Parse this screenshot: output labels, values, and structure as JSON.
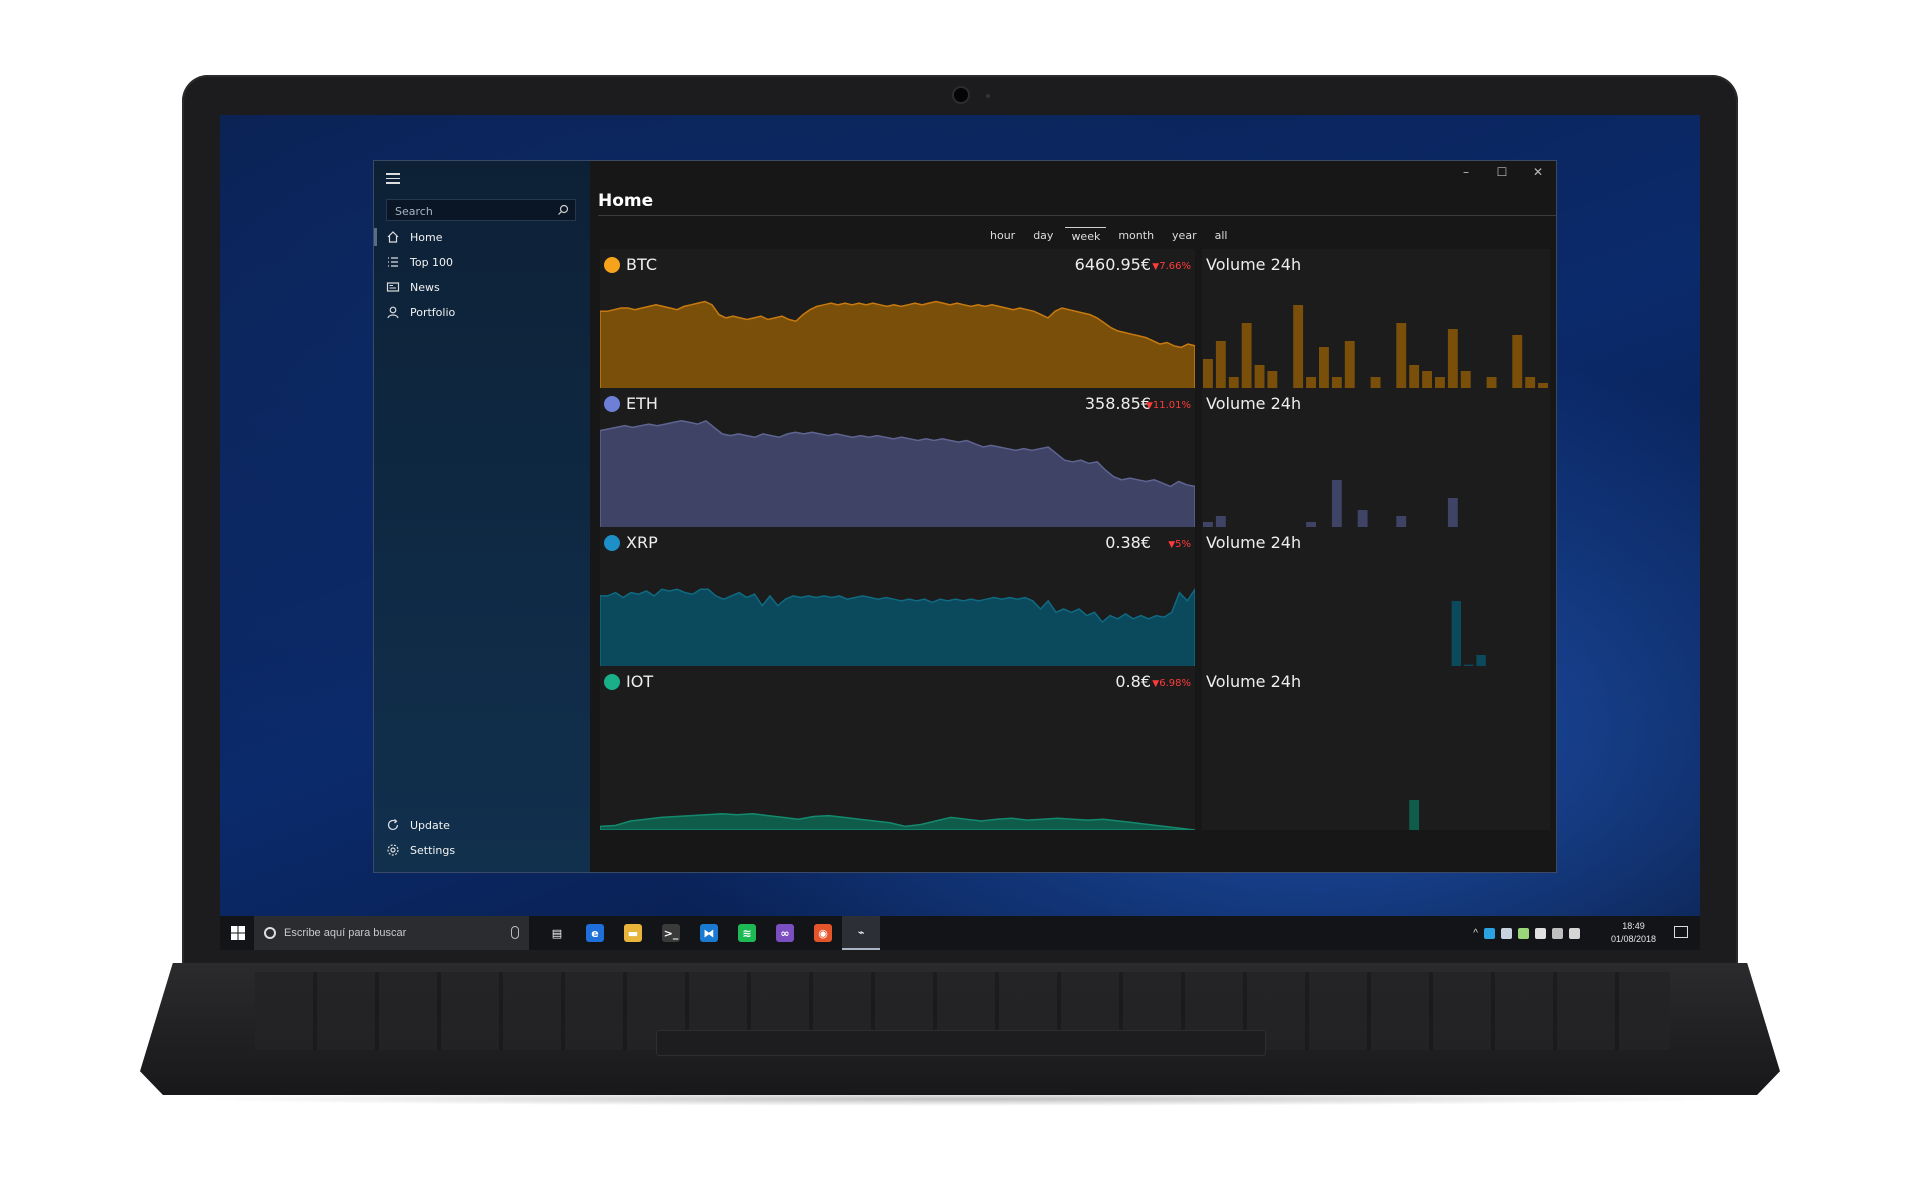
{
  "app": {
    "title": "Home",
    "search": {
      "placeholder": "Search"
    },
    "nav": [
      {
        "label": "Home",
        "icon": "home-icon",
        "active": true
      },
      {
        "label": "Top 100",
        "icon": "list-icon",
        "active": false
      },
      {
        "label": "News",
        "icon": "news-icon",
        "active": false
      },
      {
        "label": "Portfolio",
        "icon": "person-icon",
        "active": false
      }
    ],
    "nav_bottom": [
      {
        "label": "Update",
        "icon": "refresh-icon"
      },
      {
        "label": "Settings",
        "icon": "gear-icon"
      }
    ],
    "window_buttons": {
      "minimize": "–",
      "maximize": "☐",
      "close": "✕"
    },
    "ranges": [
      {
        "label": "hour",
        "active": false
      },
      {
        "label": "day",
        "active": false
      },
      {
        "label": "week",
        "active": true
      },
      {
        "label": "month",
        "active": false
      },
      {
        "label": "year",
        "active": false
      },
      {
        "label": "all",
        "active": false
      }
    ],
    "volume_title": "Volume 24h"
  },
  "coins": [
    {
      "symbol": "BTC",
      "price": "6460.95€",
      "change": "7.66%",
      "color": "#c77a10",
      "fill": "#7a4f0a",
      "icon_color": "#f7a21b"
    },
    {
      "symbol": "ETH",
      "price": "358.85€",
      "change": "11.01%",
      "color": "#5f6491",
      "fill": "#3f4365",
      "icon_color": "#6e7fd8"
    },
    {
      "symbol": "XRP",
      "price": "0.38€",
      "change": "5%",
      "color": "#0f6a82",
      "fill": "#0b4a5c",
      "icon_color": "#1e90c8"
    },
    {
      "symbol": "IOT",
      "price": "0.8€",
      "change": "6.98%",
      "color": "#138a6e",
      "fill": "#0f5c4a",
      "icon_color": "#19b089"
    }
  ],
  "chart_data": [
    {
      "type": "area",
      "series": [
        {
          "name": "BTC",
          "values": [
            62,
            62,
            63,
            64,
            64,
            63,
            64,
            65,
            66,
            65,
            64,
            63,
            65,
            66,
            67,
            68,
            66,
            60,
            58,
            59,
            58,
            57,
            58,
            59,
            57,
            58,
            59,
            57,
            56,
            60,
            63,
            65,
            66,
            67,
            66,
            67,
            66,
            67,
            66,
            67,
            66,
            65,
            66,
            65,
            66,
            67,
            66,
            67,
            68,
            67,
            66,
            67,
            66,
            65,
            66,
            65,
            66,
            65,
            64,
            63,
            64,
            63,
            62,
            60,
            58,
            62,
            64,
            63,
            62,
            61,
            60,
            58,
            55,
            52,
            50,
            49,
            48,
            47,
            46,
            44,
            42,
            43,
            41,
            40,
            42,
            41
          ]
        }
      ]
    },
    {
      "type": "area",
      "series": [
        {
          "name": "ETH",
          "values": [
            74,
            75,
            76,
            77,
            76,
            77,
            78,
            77,
            78,
            79,
            80,
            79,
            78,
            80,
            76,
            72,
            71,
            72,
            71,
            70,
            72,
            71,
            70,
            72,
            73,
            72,
            73,
            72,
            71,
            72,
            71,
            70,
            71,
            70,
            71,
            70,
            69,
            70,
            69,
            68,
            69,
            68,
            69,
            68,
            67,
            68,
            66,
            64,
            65,
            64,
            63,
            62,
            63,
            62,
            63,
            64,
            60,
            56,
            55,
            56,
            54,
            55,
            50,
            46,
            44,
            45,
            44,
            43,
            44,
            42,
            40,
            43,
            41,
            40
          ]
        }
      ]
    },
    {
      "type": "area",
      "series": [
        {
          "name": "XRP",
          "values": [
            58,
            58,
            60,
            57,
            60,
            59,
            61,
            58,
            62,
            61,
            62,
            60,
            59,
            62,
            62,
            58,
            56,
            58,
            60,
            57,
            59,
            52,
            58,
            52,
            56,
            58,
            57,
            58,
            57,
            58,
            57,
            58,
            56,
            57,
            58,
            57,
            56,
            57,
            56,
            55,
            56,
            55,
            56,
            54,
            56,
            55,
            56,
            55,
            56,
            55,
            56,
            57,
            56,
            57,
            56,
            57,
            55,
            50,
            55,
            48,
            50,
            48,
            50,
            46,
            48,
            42,
            46,
            44,
            47,
            44,
            46,
            44,
            46,
            45,
            48,
            60,
            55,
            62
          ]
        }
      ]
    },
    {
      "type": "area",
      "series": [
        {
          "name": "IOT",
          "values": [
            4,
            5,
            10,
            12,
            14,
            15,
            16,
            17,
            18,
            17,
            18,
            16,
            14,
            12,
            15,
            16,
            14,
            12,
            10,
            8,
            4,
            6,
            10,
            14,
            12,
            10,
            12,
            13,
            11,
            12,
            13,
            12,
            11,
            12,
            10,
            8,
            6,
            4,
            2,
            0
          ]
        }
      ]
    },
    {
      "type": "bar",
      "series": [
        {
          "name": "BTC Volume 24h",
          "values": [
            45,
            60,
            30,
            75,
            40,
            35,
            15,
            90,
            30,
            55,
            30,
            60,
            15,
            30,
            15,
            75,
            40,
            35,
            30,
            70,
            35,
            15,
            30,
            15,
            65,
            30,
            25
          ]
        }
      ]
    },
    {
      "type": "bar",
      "series": [
        {
          "name": "ETH Volume 24h",
          "values": [
            25,
            30,
            12,
            10,
            12,
            10,
            12,
            10,
            25,
            10,
            60,
            12,
            35,
            10,
            20,
            30,
            15,
            20,
            10,
            45,
            15,
            20,
            10,
            12,
            10,
            15,
            12
          ]
        }
      ]
    },
    {
      "type": "bar",
      "series": [
        {
          "name": "XRP Volume 24h",
          "values": [
            5,
            12,
            5,
            8,
            5,
            14,
            6,
            12,
            5,
            18,
            5,
            8,
            5,
            3,
            8,
            5,
            6,
            5,
            6,
            5,
            75,
            22,
            30,
            18,
            12,
            5,
            12,
            6
          ]
        }
      ]
    },
    {
      "type": "bar",
      "series": [
        {
          "name": "IOT Volume 24h",
          "values": [
            0,
            0,
            0,
            0,
            0,
            0,
            0,
            0,
            0,
            0,
            0,
            0,
            0,
            0,
            0,
            0,
            25,
            0,
            0,
            0,
            0,
            0,
            0,
            0,
            0,
            0,
            0
          ]
        }
      ]
    }
  ],
  "taskbar": {
    "search_placeholder": "Escribe aquí para buscar",
    "apps": [
      {
        "name": "task-view-icon",
        "glyph": "▤",
        "bg": "transparent",
        "active": false
      },
      {
        "name": "edge-icon",
        "glyph": "e",
        "bg": "#1e6fd9",
        "active": false
      },
      {
        "name": "file-explorer-icon",
        "glyph": "▬",
        "bg": "#e8b53a",
        "active": false
      },
      {
        "name": "terminal-icon",
        "glyph": ">_",
        "bg": "#3a3a3a",
        "active": false
      },
      {
        "name": "vscode-icon",
        "glyph": "⧓",
        "bg": "#1a7ad1",
        "active": false
      },
      {
        "name": "spotify-icon",
        "glyph": "≋",
        "bg": "#1db954",
        "active": false
      },
      {
        "name": "visual-studio-icon",
        "glyph": "∞",
        "bg": "#7b4fc2",
        "active": false
      },
      {
        "name": "firefox-icon",
        "glyph": "◉",
        "bg": "#e5552c",
        "active": false
      },
      {
        "name": "crypto-app-icon",
        "glyph": "⌁",
        "bg": "transparent",
        "active": true
      }
    ],
    "time": "18:49",
    "date": "01/08/2018"
  }
}
